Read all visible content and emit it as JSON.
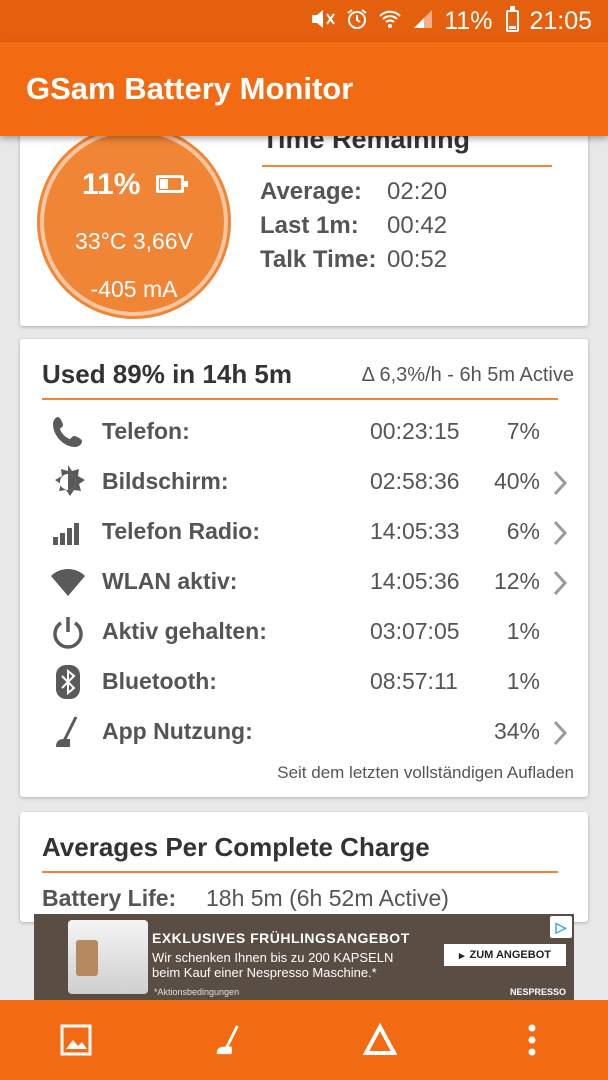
{
  "status_bar": {
    "battery_percent": "11%",
    "time": "21:05",
    "icons": [
      "mute-icon",
      "alarm-icon",
      "wifi-icon",
      "signal-icon",
      "battery-icon"
    ]
  },
  "app_bar": {
    "title": "GSam Battery Monitor"
  },
  "summary": {
    "gauge": {
      "percent": "11%",
      "temp_voltage": "33°C  3,66V",
      "current": "-405 mA",
      "level": 0.11
    },
    "time_remaining": {
      "title": "Time Remaining",
      "rows": [
        {
          "label": "Average:",
          "value": "02:20"
        },
        {
          "label": "Last 1m:",
          "value": "00:42"
        },
        {
          "label": "Talk Time:",
          "value": "00:52"
        }
      ]
    }
  },
  "usage": {
    "title": "Used 89% in 14h 5m",
    "subtitle": "Δ 6,3%/h - 6h 5m Active",
    "rows": [
      {
        "icon": "phone-icon",
        "label": "Telefon:",
        "time": "00:23:15",
        "percent": "7%",
        "chevron": false
      },
      {
        "icon": "brightness-icon",
        "label": "Bildschirm:",
        "time": "02:58:36",
        "percent": "40%",
        "chevron": true
      },
      {
        "icon": "signal-bars-icon",
        "label": "Telefon Radio:",
        "time": "14:05:33",
        "percent": "6%",
        "chevron": true
      },
      {
        "icon": "wifi-icon",
        "label": "WLAN aktiv:",
        "time": "14:05:36",
        "percent": "12%",
        "chevron": true
      },
      {
        "icon": "power-icon",
        "label": "Aktiv gehalten:",
        "time": "03:07:05",
        "percent": "1%",
        "chevron": false
      },
      {
        "icon": "bluetooth-icon",
        "label": "Bluetooth:",
        "time": "08:57:11",
        "percent": "1%",
        "chevron": false
      },
      {
        "icon": "app-usage-icon",
        "label": "App Nutzung:",
        "time": "",
        "percent": "34%",
        "chevron": true
      }
    ],
    "footnote": "Seit dem letzten vollständigen Aufladen"
  },
  "averages": {
    "title": "Averages Per Complete Charge",
    "battery_life_label": "Battery Life:",
    "battery_life_value": "18h 5m (6h 52m Active)"
  },
  "ad": {
    "headline": "EXKLUSIVES FRÜHLINGSANGEBOT",
    "line1": "Wir schenken Ihnen bis zu 200 KAPSELN",
    "line2": "beim Kauf einer Nespresso Maschine.*",
    "disclaimer": "*Aktionsbedingungen",
    "cta": "ZUM ANGEBOT",
    "brand": "NESPRESSO"
  },
  "bottom_bar": {
    "buttons": [
      "image-icon",
      "app-usage-icon",
      "delta-icon",
      "more-vert-icon"
    ]
  },
  "colors": {
    "primary": "#f26b12",
    "status": "#e4600e",
    "gauge": "#f08536",
    "accent_line": "#f08536"
  }
}
